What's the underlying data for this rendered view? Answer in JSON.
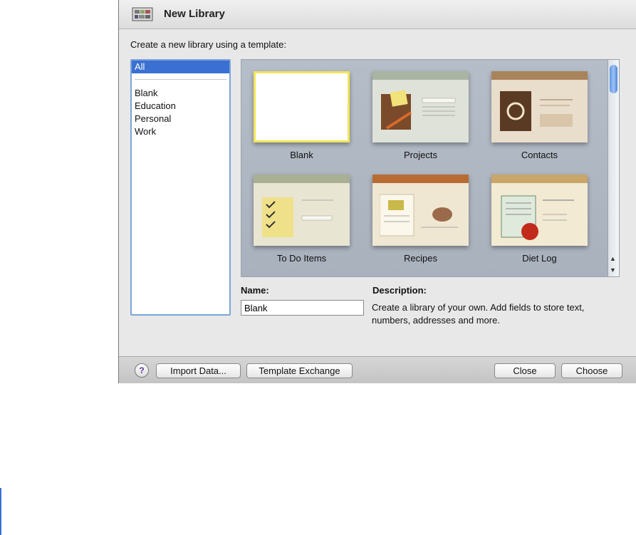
{
  "window": {
    "title": "New Library",
    "title_icon": "library-shelf-icon"
  },
  "subtitle": "Create a new library using a template:",
  "sidebar": {
    "selected": "All",
    "items": [
      {
        "label": "Blank"
      },
      {
        "label": "Education"
      },
      {
        "label": "Personal"
      },
      {
        "label": "Work"
      }
    ]
  },
  "templates": [
    {
      "label": "Blank",
      "selected": true,
      "band_color": "#ffffff"
    },
    {
      "label": "Projects",
      "band_color": "#a9b4a2"
    },
    {
      "label": "Contacts",
      "band_color": "#a9835c"
    },
    {
      "label": "To Do Items",
      "band_color": "#a9b094"
    },
    {
      "label": "Recipes",
      "band_color": "#b86c34"
    },
    {
      "label": "Diet Log",
      "band_color": "#c9a66a"
    }
  ],
  "form": {
    "name_label": "Name:",
    "name_value": "Blank",
    "description_label": "Description:",
    "description_text": "Create a library of your own. Add fields to store text, numbers, addresses and more."
  },
  "buttons": {
    "help": "?",
    "import": "Import Data...",
    "exchange": "Template Exchange",
    "close": "Close",
    "choose": "Choose"
  },
  "colors": {
    "selection": "#3a70d1",
    "accent": "#f2e55a"
  }
}
